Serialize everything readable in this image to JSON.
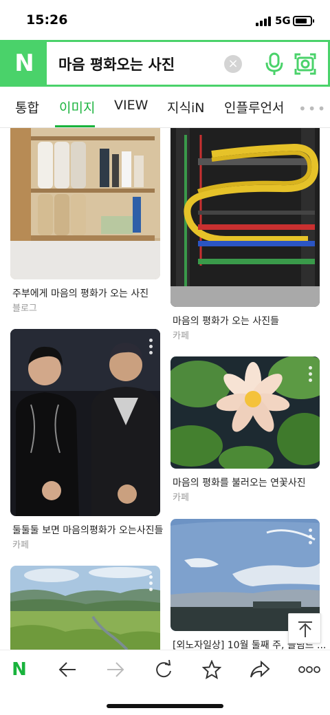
{
  "status_bar": {
    "time": "15:26",
    "network": "5G",
    "battery_level": 0.8
  },
  "search": {
    "logo": "N",
    "query": "마음 평화오는 사진",
    "clear_icon": "close-icon",
    "mic_icon": "microphone-icon",
    "lens_icon": "camera-lens-icon"
  },
  "tabs": [
    {
      "label": "통합",
      "active": false
    },
    {
      "label": "이미지",
      "active": true
    },
    {
      "label": "VIEW",
      "active": false
    },
    {
      "label": "지식iN",
      "active": false
    },
    {
      "label": "인플루언서",
      "active": false
    }
  ],
  "tabs_more": "•••",
  "results": [
    {
      "title": "주부에게 마음의 평화가 오는 사진",
      "source": "블로그",
      "image": "bathroom-shelf-photo"
    },
    {
      "title": "마음의 평화가 오는 사진들",
      "source": "카페",
      "image": "server-rack-cables-photo"
    },
    {
      "title": "둘둘둘 보면 마음의평화가 오는사진들",
      "source": "카페",
      "image": "two-men-stage-photo"
    },
    {
      "title": "마음의 평화를 불러오는 연꽃사진",
      "source": "카페",
      "image": "lotus-flower-photo"
    },
    {
      "title": "",
      "source": "",
      "image": "green-valley-photo"
    },
    {
      "title": "[외노자일상] 10월 둘째 주, 슬림드 ...",
      "source": "",
      "image": "sky-clouds-photo"
    }
  ],
  "toolbar": {
    "items": [
      "naver-home-icon",
      "back-icon",
      "forward-icon",
      "refresh-icon",
      "star-icon",
      "share-icon",
      "more-icon"
    ],
    "home_label": "N"
  },
  "colors": {
    "brand_green": "#4ad26a",
    "active_tab": "#19b33c"
  }
}
